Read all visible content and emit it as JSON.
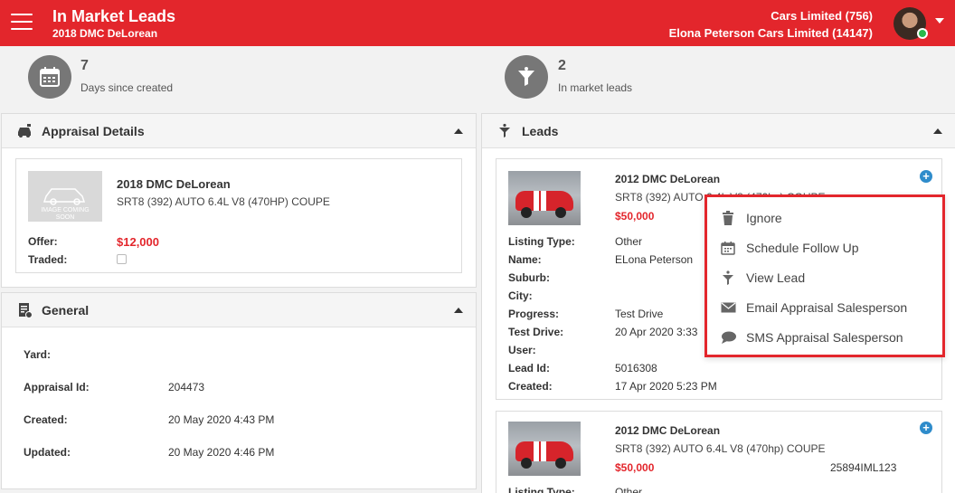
{
  "header": {
    "title": "In Market Leads",
    "subtitle": "2018 DMC DeLorean",
    "account_line1": "Cars Limited (756)",
    "account_line2": "Elona Peterson Cars Limited (14147)"
  },
  "stats": [
    {
      "value": "7",
      "label": "Days since created",
      "icon": "calendar-icon"
    },
    {
      "value": "2",
      "label": "In market leads",
      "icon": "funnel-icon"
    }
  ],
  "appraisal": {
    "title": "Appraisal Details",
    "car_title": "2018 DMC DeLorean",
    "car_spec": "SRT8 (392) AUTO 6.4L V8 (470HP) COUPE",
    "placeholder_text": "IMAGE COMING SOON",
    "offer_label": "Offer:",
    "offer_value": "$12,000",
    "traded_label": "Traded:"
  },
  "general": {
    "title": "General",
    "rows": [
      {
        "label": "Yard:",
        "value": ""
      },
      {
        "label": "Appraisal Id:",
        "value": "204473"
      },
      {
        "label": "Created:",
        "value": "20 May 2020 4:43 PM"
      },
      {
        "label": "Updated:",
        "value": "20 May 2020 4:46 PM"
      }
    ]
  },
  "leads": {
    "title": "Leads",
    "items": [
      {
        "car_title": "2012 DMC DeLorean",
        "car_spec": "SRT8 (392) AUTO 6.4L V8 (470hp) COUPE",
        "price": "$50,000",
        "fields": [
          {
            "label": "Listing Type:",
            "value": "Other"
          },
          {
            "label": "Name:",
            "value": "ELona Peterson"
          },
          {
            "label": "Suburb:",
            "value": ""
          },
          {
            "label": "City:",
            "value": ""
          },
          {
            "label": "Progress:",
            "value": "Test Drive"
          },
          {
            "label": "Test Drive:",
            "value": "20 Apr 2020 3:33"
          },
          {
            "label": "User:",
            "value": ""
          },
          {
            "label": "Lead Id:",
            "value": "5016308"
          },
          {
            "label": "Created:",
            "value": "17 Apr 2020 5:23 PM"
          }
        ]
      },
      {
        "car_title": "2012 DMC DeLorean",
        "car_spec": "SRT8 (392) AUTO 6.4L V8 (470hp) COUPE",
        "price": "$50,000",
        "stock": "25894IML123",
        "fields": [
          {
            "label": "Listing Type:",
            "value": "Other"
          }
        ]
      }
    ]
  },
  "menu": {
    "items": [
      {
        "label": "Ignore",
        "icon": "trash-icon"
      },
      {
        "label": "Schedule Follow Up",
        "icon": "calendar-icon"
      },
      {
        "label": "View Lead",
        "icon": "funnel-icon"
      },
      {
        "label": "Email Appraisal Salesperson",
        "icon": "envelope-icon"
      },
      {
        "label": "SMS Appraisal Salesperson",
        "icon": "chat-bubble-icon"
      }
    ]
  },
  "colors": {
    "brand": "#e3262c",
    "accent_blue": "#2f8ccb",
    "online": "#29b94a"
  }
}
